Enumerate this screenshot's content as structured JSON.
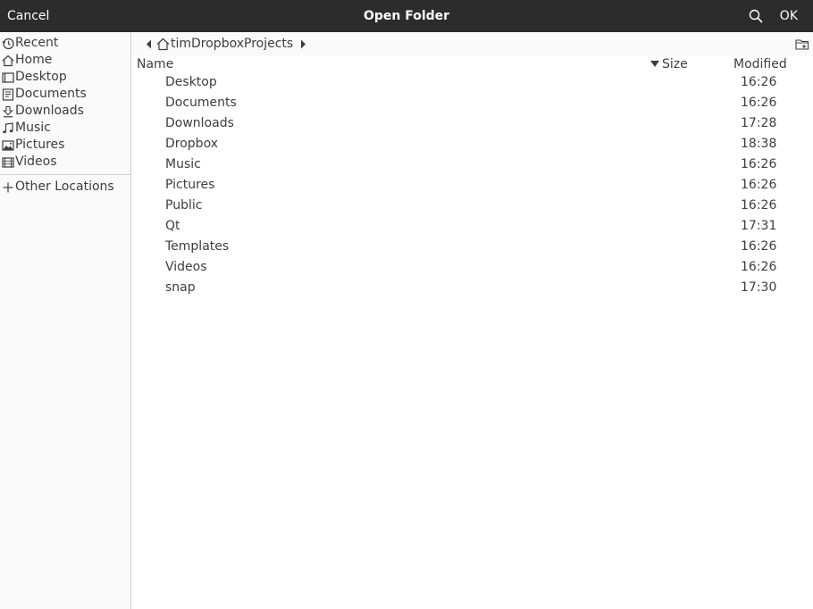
{
  "header": {
    "cancel_label": "Cancel",
    "title": "Open Folder",
    "ok_label": "OK",
    "search_icon": "search-icon"
  },
  "sidebar": {
    "items": [
      {
        "label": "Recent",
        "icon": "clock-icon"
      },
      {
        "label": "Home",
        "icon": "home-icon"
      },
      {
        "label": "Desktop",
        "icon": "desktop-icon"
      },
      {
        "label": "Documents",
        "icon": "document-icon"
      },
      {
        "label": "Downloads",
        "icon": "download-icon"
      },
      {
        "label": "Music",
        "icon": "music-icon"
      },
      {
        "label": "Pictures",
        "icon": "picture-icon"
      },
      {
        "label": "Videos",
        "icon": "video-icon"
      }
    ],
    "other_locations": {
      "label": "Other Locations",
      "icon": "plus-icon"
    }
  },
  "pathbar": {
    "current": "timDropboxProjects",
    "home_icon": "home-icon",
    "new_folder_icon": "new-folder-icon"
  },
  "columns": {
    "name": "Name",
    "size": "Size",
    "modified": "Modified",
    "sort_icon": "sort-descending-icon"
  },
  "files": [
    {
      "name": "Desktop",
      "modified": "16:26"
    },
    {
      "name": "Documents",
      "modified": "16:26"
    },
    {
      "name": "Downloads",
      "modified": "17:28"
    },
    {
      "name": "Dropbox",
      "modified": "18:38"
    },
    {
      "name": "Music",
      "modified": "16:26"
    },
    {
      "name": "Pictures",
      "modified": "16:26"
    },
    {
      "name": "Public",
      "modified": "16:26"
    },
    {
      "name": "Qt",
      "modified": "17:31"
    },
    {
      "name": "Templates",
      "modified": "16:26"
    },
    {
      "name": "Videos",
      "modified": "16:26"
    },
    {
      "name": "snap",
      "modified": "17:30"
    }
  ]
}
